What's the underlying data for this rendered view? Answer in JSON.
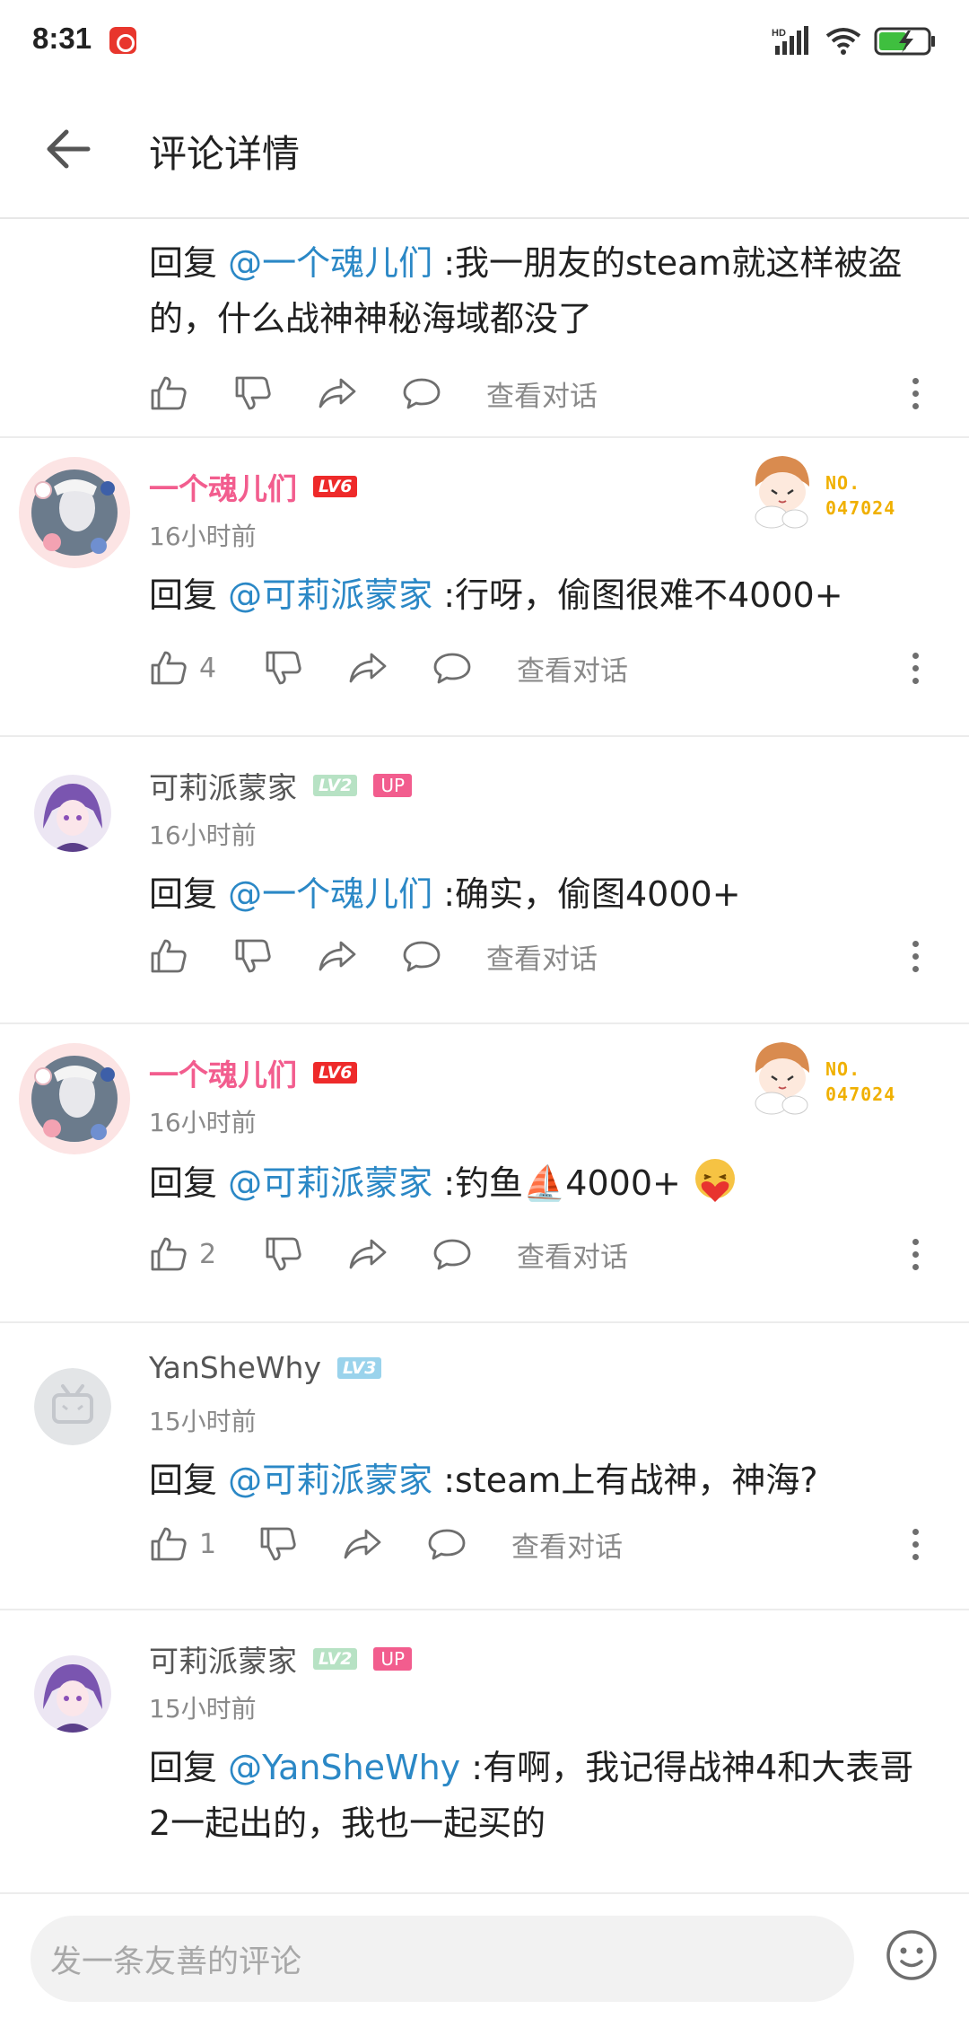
{
  "status_bar": {
    "time": "8:31",
    "network_label": "HD",
    "icons": [
      "netease-music-icon",
      "signal-icon",
      "wifi-icon",
      "battery-charging-icon"
    ]
  },
  "header": {
    "title": "评论详情",
    "back_icon": "arrow-left-icon"
  },
  "actions": {
    "view_conversation": "查看对话"
  },
  "fan_badge": {
    "no_label": "NO.",
    "number": "047024"
  },
  "comments": [
    {
      "user": "",
      "time": "",
      "reply_prefix": "回复 ",
      "mention": "@一个魂儿们",
      "text": " :我一朋友的steam就这样被盗的，什么战神神秘海域都没了",
      "likes": ""
    },
    {
      "user": "一个魂儿们",
      "level": "LV6",
      "time": "16小时前",
      "reply_prefix": "回复 ",
      "mention": "@可莉派蒙家",
      "text": " :行呀，偷图很难不4000+",
      "likes": "4"
    },
    {
      "user": "可莉派蒙家",
      "level": "LV2",
      "up": "UP",
      "time": "16小时前",
      "reply_prefix": "回复 ",
      "mention": "@一个魂儿们",
      "text": " :确实，偷图4000+",
      "likes": ""
    },
    {
      "user": "一个魂儿们",
      "level": "LV6",
      "time": "16小时前",
      "reply_prefix": "回复 ",
      "mention": "@可莉派蒙家",
      "text": " :钓鱼⛵4000+",
      "likes": "2"
    },
    {
      "user": "YanSheWhy",
      "level": "LV3",
      "time": "15小时前",
      "reply_prefix": "回复 ",
      "mention": "@可莉派蒙家",
      "text": " :steam上有战神，神海?",
      "likes": "1"
    },
    {
      "user": "可莉派蒙家",
      "level": "LV2",
      "up": "UP",
      "time": "15小时前",
      "reply_prefix": "回复 ",
      "mention": "@YanSheWhy",
      "text": " :有啊，我记得战神4和大表哥2一起出的，我也一起买的",
      "likes": ""
    }
  ],
  "input": {
    "placeholder": "发一条友善的评论"
  },
  "colors": {
    "mention": "#2b88c6",
    "vip_name": "#f25d8e",
    "secondary_text": "#8a8a8a"
  }
}
